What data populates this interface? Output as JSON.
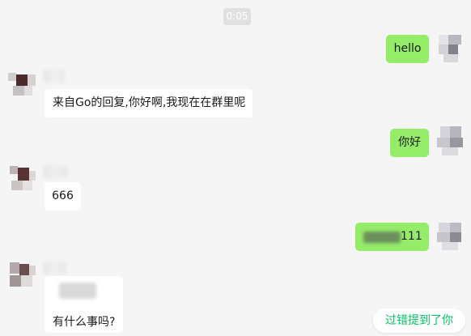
{
  "timestamp": "0:05",
  "messages": [
    {
      "side": "right",
      "text": "hello"
    },
    {
      "side": "left",
      "text": "来自Go的回复,你好啊,我现在在群里呢"
    },
    {
      "side": "right",
      "text": "你好"
    },
    {
      "side": "left",
      "text": "666"
    },
    {
      "side": "right",
      "text": "111"
    },
    {
      "side": "left",
      "text": "有什么事吗?"
    }
  ],
  "toast": "过错提到了你",
  "colors": {
    "background": "#f5f5f5",
    "self_bubble": "#95ec69",
    "other_bubble": "#ffffff",
    "toast_text": "#07c160"
  }
}
